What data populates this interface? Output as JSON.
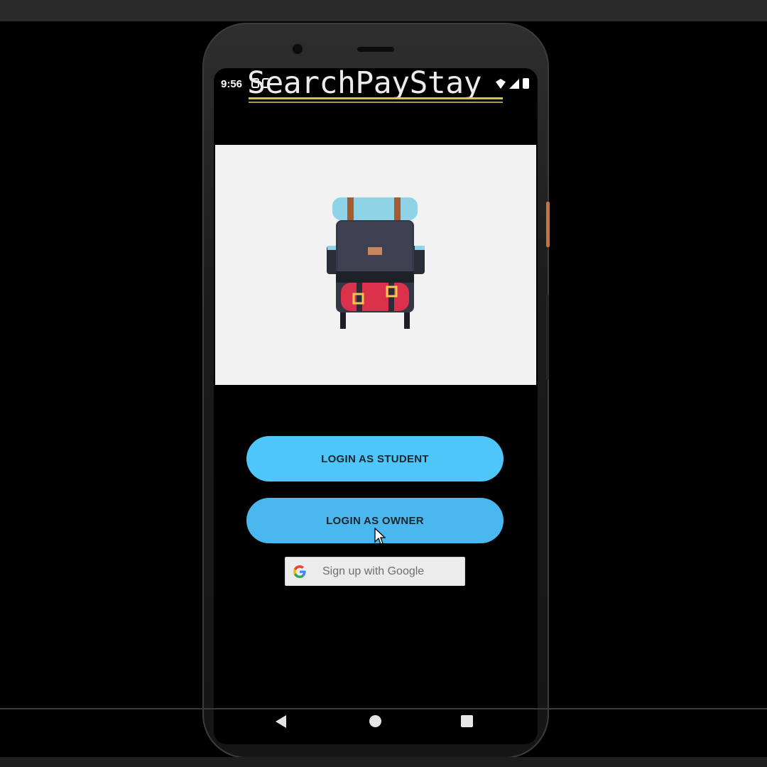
{
  "status_bar": {
    "time": "9:56"
  },
  "app": {
    "title": "SearchPayStay"
  },
  "hero": {
    "image": "backpack-illustration"
  },
  "buttons": {
    "student_label": "LOGIN AS STUDENT",
    "owner_label": "LOGIN AS OWNER",
    "google_label": "Sign up with Google"
  },
  "colors": {
    "button_primary": "#4fc6f9",
    "hero_background": "#f2f2f2",
    "title_underline": "#d2c64a"
  },
  "nav": {
    "back_icon": "back-triangle",
    "home_icon": "home-circle",
    "recents_icon": "recents-square"
  }
}
